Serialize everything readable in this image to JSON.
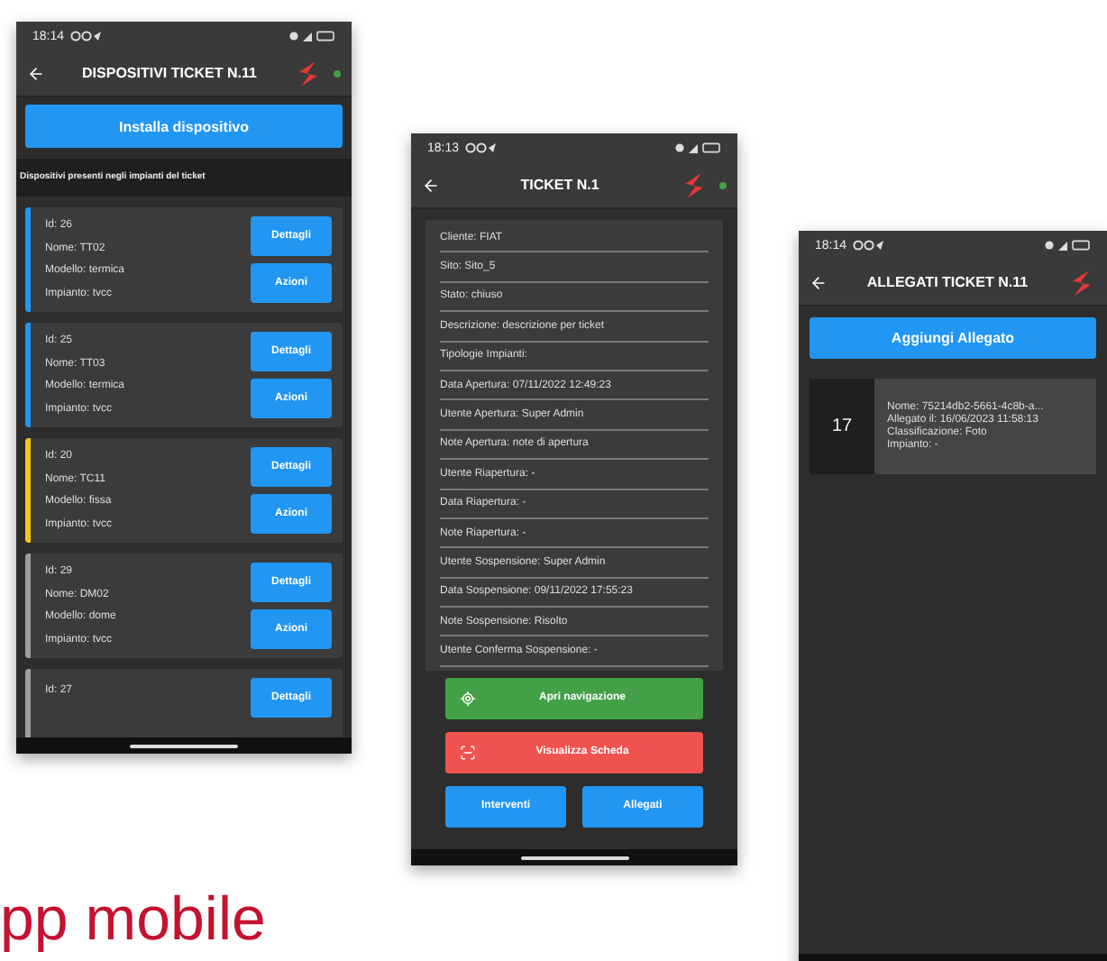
{
  "devices_screen": {
    "status_time": "18:14",
    "title": "DISPOSITIVI  TICKET N.11",
    "install_button": "Installa dispositivo",
    "subtitle": "Dispositivi presenti negli impianti del ticket",
    "devices": [
      {
        "lines": [
          "Id: 26",
          "Nome: TT02",
          "Modello: termica",
          "Impianto: tvcc"
        ],
        "color": "#2196f3",
        "details": "Dettagli",
        "actions": "Azioni"
      },
      {
        "lines": [
          "Id: 25",
          "Nome: TT03",
          "Modello: termica",
          "Impianto: tvcc"
        ],
        "color": "#2196f3",
        "details": "Dettagli",
        "actions": "Azioni"
      },
      {
        "lines": [
          "Id: 20",
          "Nome: TC11",
          "Modello: fissa",
          "Impianto: tvcc"
        ],
        "color": "#f5c518",
        "details": "Dettagli",
        "actions": "Azioni"
      },
      {
        "lines": [
          "Id: 29",
          "Nome: DM02",
          "Modello: dome",
          "Impianto: tvcc"
        ],
        "color": "#9e9e9e",
        "details": "Dettagli",
        "actions": "Azioni"
      },
      {
        "lines": [
          "Id: 27"
        ],
        "color": "#9e9e9e",
        "details": "Dettagli"
      }
    ]
  },
  "ticket_screen": {
    "status_time": "18:13",
    "title": "TICKET N.1",
    "fields": [
      "Cliente: FIAT",
      "Sito: Sito_5",
      "Stato: chiuso",
      "Descrizione: descrizione per ticket",
      "Tipologie Impianti:",
      "Data Apertura: 07/11/2022 12:49:23",
      "Utente Apertura: Super Admin",
      "Note Apertura: note di apertura",
      "Utente Riapertura: -",
      "Data Riapertura: -",
      "Note Riapertura: -",
      "Utente Sospensione: Super Admin",
      "Data Sospensione: 09/11/2022 17:55:23",
      "Note Sospensione: Risolto",
      "Utente Conferma Sospensione: -"
    ],
    "wide_buttons": [
      {
        "label": "Apri navigazione",
        "kind": "locate",
        "color": "#43a047"
      },
      {
        "label": "Visualizza Scheda",
        "kind": "scan",
        "color": "#ef5350"
      }
    ],
    "half_buttons": [
      "Interventi",
      "Allegati"
    ]
  },
  "attachments_screen": {
    "status_time": "18:14",
    "title": "ALLEGATI TICKET N.11",
    "add_button": "Aggiungi Allegato",
    "attachments": [
      {
        "number": "17",
        "lines": [
          "Nome: 75214db2-5661-4c8b-a...",
          "Allegato il: 16/06/2023 11:58:13",
          "Classificazione: Foto",
          "Impianto: -"
        ]
      }
    ]
  },
  "headline": "pp mobile"
}
